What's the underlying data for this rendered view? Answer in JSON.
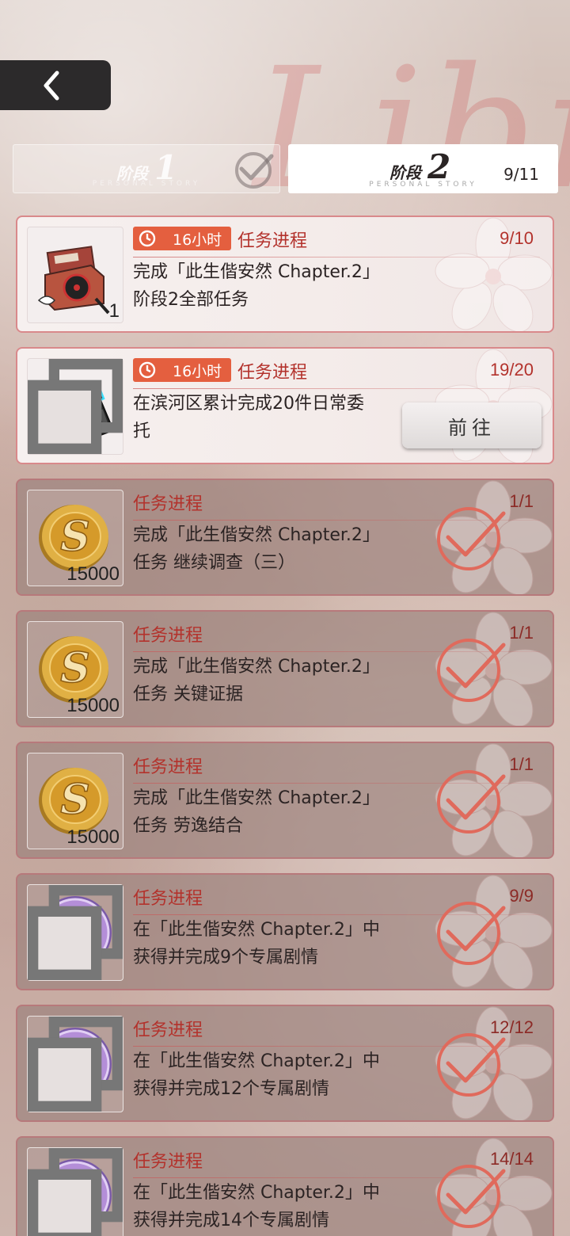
{
  "watermark": "Libra",
  "nav": {
    "back_icon": "chevron-left-icon"
  },
  "stages": [
    {
      "label": "阶段",
      "number": "1",
      "subtitle": "PERSONAL STORY",
      "completed": true
    },
    {
      "label": "阶段",
      "number": "2",
      "subtitle": "PERSONAL STORY",
      "count": "9/11",
      "selected": true
    }
  ],
  "tasks": [
    {
      "state": "active",
      "timer": "16小时",
      "title": "任务进程",
      "progress": "9/10",
      "desc": [
        "完成「此生偕安然 Chapter.2」",
        "阶段2全部任务"
      ],
      "reward": "record-box",
      "qty": "1"
    },
    {
      "state": "active",
      "timer": "16小时",
      "title": "任务进程",
      "progress": "19/20",
      "desc": [
        "在滨河区累计完成20件日常委",
        "托"
      ],
      "reward": "pistol",
      "qty": "",
      "button": "前往"
    },
    {
      "state": "done",
      "title": "任务进程",
      "progress": "1/1",
      "desc": [
        "完成「此生偕安然 Chapter.2」",
        "任务 继续调查（三）"
      ],
      "reward": "coin",
      "qty": "15000"
    },
    {
      "state": "done",
      "title": "任务进程",
      "progress": "1/1",
      "desc": [
        "完成「此生偕安然 Chapter.2」",
        "任务 关键证据"
      ],
      "reward": "coin",
      "qty": "15000"
    },
    {
      "state": "done",
      "title": "任务进程",
      "progress": "1/1",
      "desc": [
        "完成「此生偕安然 Chapter.2」",
        "任务 劳逸结合"
      ],
      "reward": "coin",
      "qty": "15000"
    },
    {
      "state": "done",
      "title": "任务进程",
      "progress": "9/9",
      "desc": [
        "在「此生偕安然 Chapter.2」中",
        "获得并完成9个专属剧情"
      ],
      "reward": "libra-medal",
      "qty": ""
    },
    {
      "state": "done",
      "title": "任务进程",
      "progress": "12/12",
      "desc": [
        "在「此生偕安然 Chapter.2」中",
        "获得并完成12个专属剧情"
      ],
      "reward": "libra-medal",
      "qty": ""
    },
    {
      "state": "done",
      "title": "任务进程",
      "progress": "14/14",
      "desc": [
        "在「此生偕安然 Chapter.2」中",
        "获得并完成14个专属剧情"
      ],
      "reward": "libra-medal",
      "qty": ""
    }
  ],
  "colors": {
    "accent": "#e45f3f",
    "title_red": "#b3322c",
    "check": "#e06a5c"
  }
}
